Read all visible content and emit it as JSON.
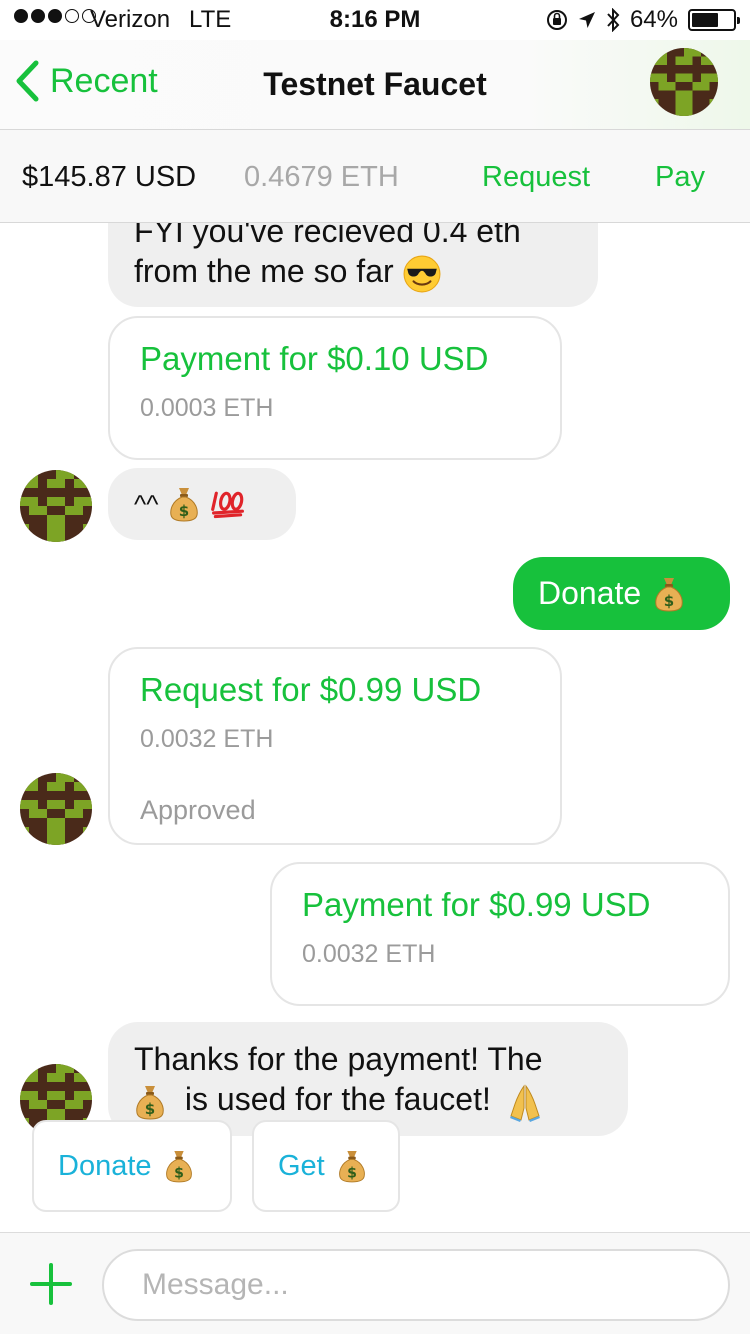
{
  "status_bar": {
    "carrier": "Verizon",
    "network": "LTE",
    "time": "8:16 PM",
    "battery_percent": "64%",
    "battery_level": 0.64,
    "signal_bars_filled": 3,
    "signal_bars_total": 5,
    "icons": [
      "orientation-lock-icon",
      "location-arrow-icon",
      "bluetooth-icon",
      "battery-icon"
    ]
  },
  "nav": {
    "back_label": "Recent",
    "title": "Testnet Faucet"
  },
  "balance": {
    "usd": "$145.87 USD",
    "eth": "0.4679 ETH",
    "request_label": "Request",
    "pay_label": "Pay"
  },
  "messages": {
    "m1": {
      "line1": "FYI you've recieved 0.4 eth",
      "line2": "from the me so far",
      "emoji": "smiling-face-with-sunglasses-icon"
    },
    "m2": {
      "title": "Payment for $0.10 USD",
      "eth": "0.0003 ETH"
    },
    "m3": {
      "text": "^^",
      "emojis": [
        "money-bag-icon",
        "hundred-points-icon"
      ]
    },
    "m4": {
      "text": "Donate",
      "emoji": "money-bag-icon"
    },
    "m5": {
      "title": "Request for $0.99 USD",
      "eth": "0.0032 ETH",
      "status": "Approved"
    },
    "m6": {
      "title": "Payment for $0.99 USD",
      "eth": "0.0032 ETH"
    },
    "m7": {
      "line1": "Thanks for the payment! The",
      "line2": "is used for the faucet!",
      "emojis": [
        "money-bag-icon",
        "folded-hands-icon"
      ]
    }
  },
  "quick_replies": [
    {
      "label": "Donate",
      "emoji": "money-bag-icon"
    },
    {
      "label": "Get",
      "emoji": "money-bag-icon"
    }
  ],
  "composer": {
    "placeholder": "Message...",
    "value": ""
  },
  "colors": {
    "accent_green": "#17c13c",
    "quick_reply_blue": "#1ab2d9",
    "bubble_gray": "#efefef"
  }
}
